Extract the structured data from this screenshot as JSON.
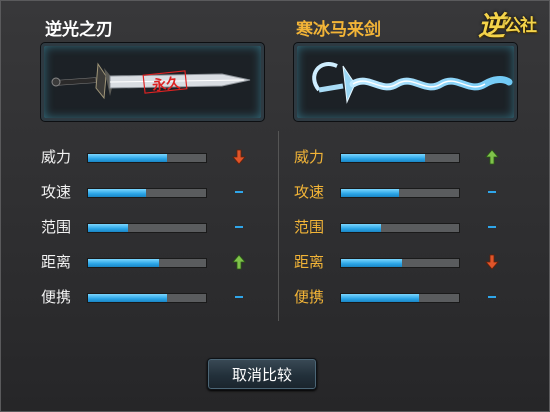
{
  "logo": {
    "text_big": "逆",
    "text_small": "公社"
  },
  "left": {
    "title": "逆光之刃",
    "seal": "永久",
    "stats": [
      {
        "label": "威力",
        "fill": 0.67,
        "change": "down"
      },
      {
        "label": "攻速",
        "fill": 0.49,
        "change": "none"
      },
      {
        "label": "范围",
        "fill": 0.34,
        "change": "none"
      },
      {
        "label": "距离",
        "fill": 0.6,
        "change": "up"
      },
      {
        "label": "便携",
        "fill": 0.67,
        "change": "none"
      }
    ]
  },
  "right": {
    "title": "寒冰马来剑",
    "stats": [
      {
        "label": "威力",
        "fill": 0.71,
        "change": "up"
      },
      {
        "label": "攻速",
        "fill": 0.49,
        "change": "none"
      },
      {
        "label": "范围",
        "fill": 0.34,
        "change": "none"
      },
      {
        "label": "距离",
        "fill": 0.52,
        "change": "down"
      },
      {
        "label": "便携",
        "fill": 0.66,
        "change": "none"
      }
    ]
  },
  "cancel_button": "取消比较",
  "colors": {
    "down": "#e0552a",
    "up": "#7fc24a",
    "none": "#2fa6ea",
    "bar": "#2aa4e6"
  }
}
